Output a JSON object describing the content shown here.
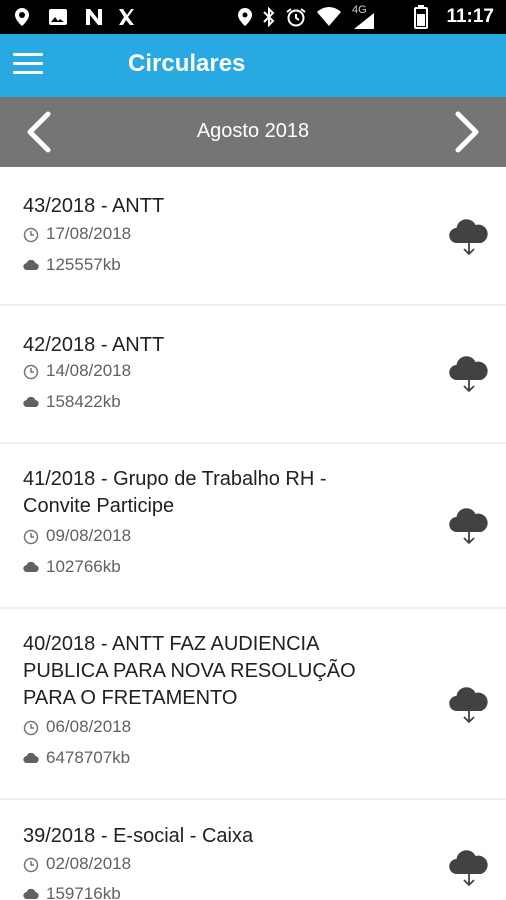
{
  "status_bar": {
    "time": "11:17",
    "network": "4G",
    "icons": [
      "location-pin-icon",
      "gallery-icon",
      "n-notification-icon",
      "app-notification-icon",
      "location-icon",
      "bluetooth-icon",
      "alarm-icon",
      "wifi-icon",
      "signal-icon",
      "battery-icon"
    ]
  },
  "app_bar": {
    "title": "Circulares",
    "menu_icon": "hamburger-menu-icon",
    "background": "#29a9e1"
  },
  "month_nav": {
    "label": "Agosto 2018",
    "prev_icon": "chevron-left-icon",
    "next_icon": "chevron-right-icon",
    "background": "#757575"
  },
  "circulars": [
    {
      "title": "43/2018 - ANTT",
      "date": "17/08/2018",
      "size": "125557kb"
    },
    {
      "title": "42/2018 - ANTT",
      "date": "14/08/2018",
      "size": "158422kb"
    },
    {
      "title": "41/2018 - Grupo de Trabalho RH - Convite Participe",
      "date": "09/08/2018",
      "size": "102766kb"
    },
    {
      "title": "40/2018 - ANTT FAZ AUDIENCIA PUBLICA PARA NOVA RESOLUÇÃO PARA O FRETAMENTO",
      "date": "06/08/2018",
      "size": "6478707kb"
    },
    {
      "title": "39/2018 - E-social - Caixa",
      "date": "02/08/2018",
      "size": "159716kb"
    }
  ]
}
